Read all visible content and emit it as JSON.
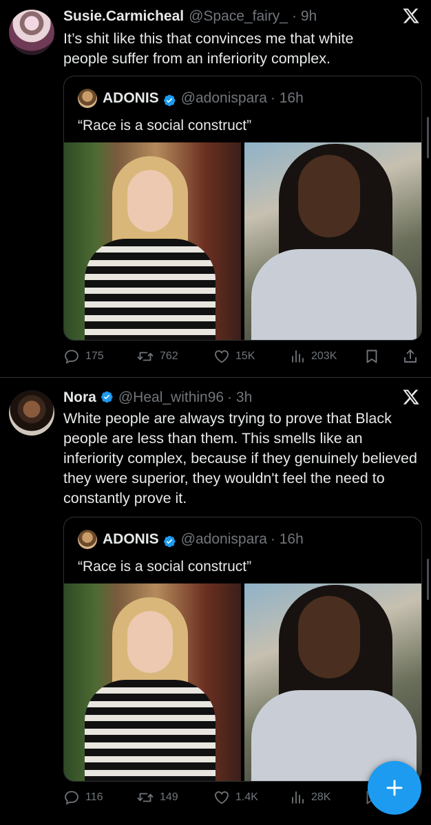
{
  "tweets": [
    {
      "name": "Susie.Carmicheal",
      "handle": "@Space_fairy_",
      "time": "· 9h",
      "text": "It’s shit like this that convinces me that white people suffer from an inferiority complex.",
      "quote": {
        "name": "ADONIS",
        "handle": "@adonispara",
        "time": "· 16h",
        "text": "“Race is a social construct”"
      },
      "actions": {
        "replies": "175",
        "reposts": "762",
        "likes": "15K",
        "views": "203K"
      }
    },
    {
      "name": "Nora",
      "handle": "@Heal_within96",
      "time": "· 3h",
      "text": "White people are always trying to prove that Black people are less than them. This smells like an inferiority complex, because if they genuinely believed they were superior, they wouldn't feel the need to constantly prove it.",
      "quote": {
        "name": "ADONIS",
        "handle": "@adonispara",
        "time": "· 16h",
        "text": "“Race is a social construct”"
      },
      "actions": {
        "replies": "116",
        "reposts": "149",
        "likes": "1.4K",
        "views": "28K"
      }
    }
  ],
  "icons": [
    "x-logo-icon",
    "verified-badge-icon",
    "reply-icon",
    "repost-icon",
    "like-icon",
    "views-icon",
    "bookmark-icon",
    "share-icon",
    "plus-icon"
  ],
  "colors": {
    "background": "#000000",
    "text": "#e7e9ea",
    "secondary": "#71767b",
    "accent": "#1d9bf0",
    "border": "#2f3336"
  }
}
